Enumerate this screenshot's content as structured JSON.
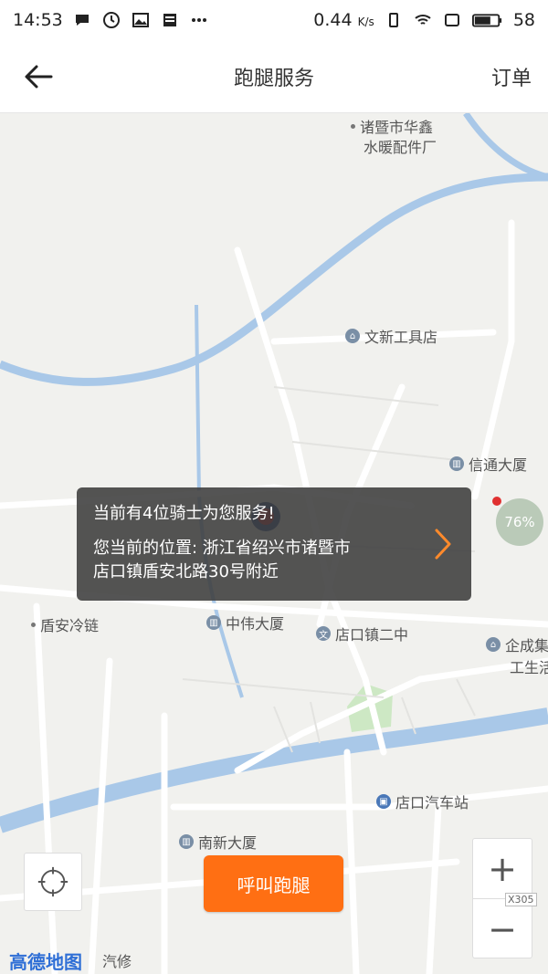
{
  "status_bar": {
    "time": "14:53",
    "speed": "0.44",
    "speed_unit": "K/s",
    "battery": "58"
  },
  "header": {
    "title": "跑腿服务",
    "orders_label": "订单"
  },
  "map": {
    "pois": [
      {
        "label": "诸暨市华鑫"
      },
      {
        "label": "水暖配件厂"
      },
      {
        "label": "文新工具店"
      },
      {
        "label": "信通大厦"
      },
      {
        "label": "盾安冷链"
      },
      {
        "label": "中伟大厦"
      },
      {
        "label": "店口镇二中"
      },
      {
        "label": "企成集"
      },
      {
        "label": "工生活"
      },
      {
        "label": "店口汽车站"
      },
      {
        "label": "南新大厦"
      },
      {
        "label": "汽修"
      }
    ],
    "bubble_percent": "76%",
    "road_label": "X305",
    "logo": "高德地图"
  },
  "info": {
    "line1": "当前有4位骑士为您服务!",
    "line2": "您当前的位置: 浙江省绍兴市诸暨市",
    "line3": "店口镇盾安北路30号附近"
  },
  "actions": {
    "call_label": "呼叫跑腿",
    "zoom_in": "+",
    "zoom_out": "−"
  },
  "colors": {
    "accent": "#ff6f13",
    "river": "#a9c8e8"
  }
}
